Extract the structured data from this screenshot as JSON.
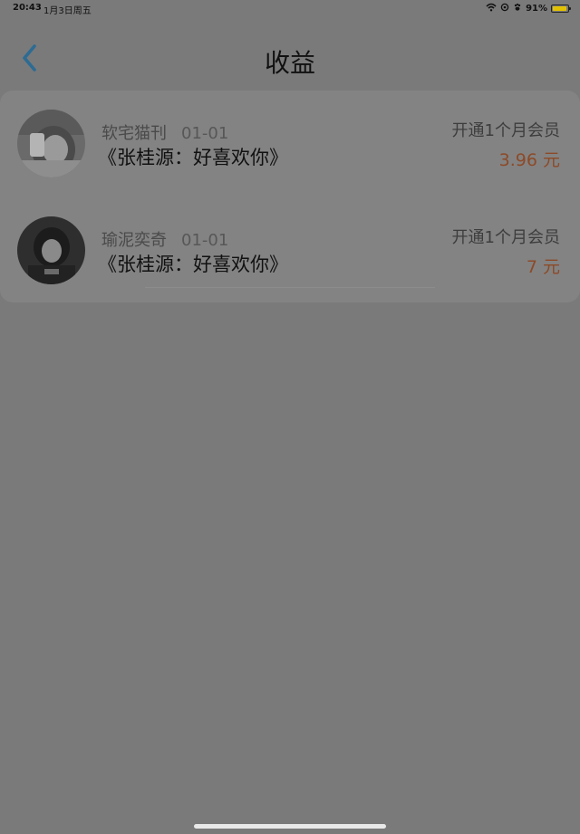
{
  "status_bar": {
    "time": "20:43",
    "date": "1月3日周五",
    "battery": "91%",
    "battery_level": 0.91
  },
  "header": {
    "title": "收益",
    "back_icon": "chevron-left-icon"
  },
  "earnings": [
    {
      "name": "软宅猫刊",
      "date": "01-01",
      "work": "《张桂源：好喜欢你》",
      "description": "开通1个月会员",
      "amount": "3.96 元"
    },
    {
      "name": "瑜泥奕奇",
      "date": "01-01",
      "work": "《张桂源：好喜欢你》",
      "description": "开通1个月会员",
      "amount": "7 元"
    }
  ],
  "colors": {
    "accent": "#2d6b93",
    "amount": "#8c4a28",
    "background": "#7a7a7a"
  }
}
